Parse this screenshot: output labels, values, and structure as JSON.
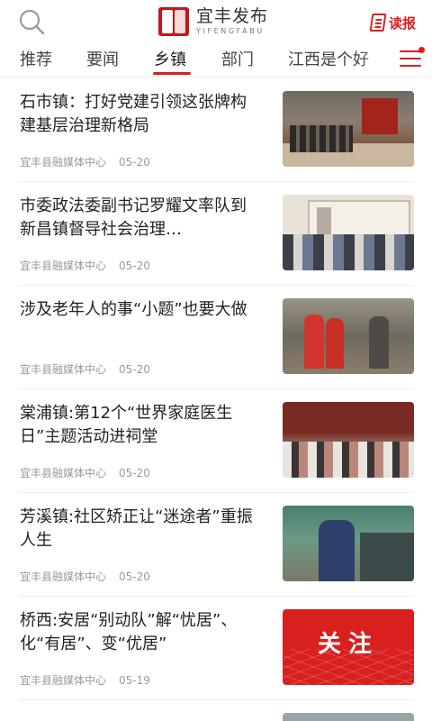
{
  "header": {
    "logo_text": "宜丰发布",
    "logo_subtext": "YIFENGFABU",
    "read_label": "读报",
    "icons": {
      "search": "search-icon",
      "read": "newspaper-icon",
      "menu": "hamburger-menu-icon"
    }
  },
  "tabs": [
    {
      "label": "推荐",
      "active": false
    },
    {
      "label": "要闻",
      "active": false
    },
    {
      "label": "乡镇",
      "active": true
    },
    {
      "label": "部门",
      "active": false
    },
    {
      "label": "江西是个好",
      "active": false
    }
  ],
  "articles": [
    {
      "title": "石市镇：打好党建引领这张牌构建基层治理新格局",
      "source": "宜丰县融媒体中心",
      "date": "05-20"
    },
    {
      "title": "市委政法委副书记罗耀文率队到新昌镇督导社会治理…",
      "source": "宜丰县融媒体中心",
      "date": "05-20"
    },
    {
      "title": "涉及老年人的事“小题”也要大做",
      "source": "宜丰县融媒体中心",
      "date": "05-20"
    },
    {
      "title": "棠浦镇:第12个“世界家庭医生日”主题活动进祠堂",
      "source": "宜丰县融媒体中心",
      "date": "05-20"
    },
    {
      "title": "芳溪镇:社区矫正让“迷途者”重振人生",
      "source": "宜丰县融媒体中心",
      "date": "05-20"
    },
    {
      "title": "桥西:安居“别动队”解“忧居”、化“有居”、变“优居”",
      "source": "宜丰县融媒体中心",
      "date": "05-19",
      "thumb_text": "关注"
    }
  ],
  "colors": {
    "accent": "#d8201f",
    "meta": "#9a9a9a",
    "divider": "#eeeeee"
  }
}
